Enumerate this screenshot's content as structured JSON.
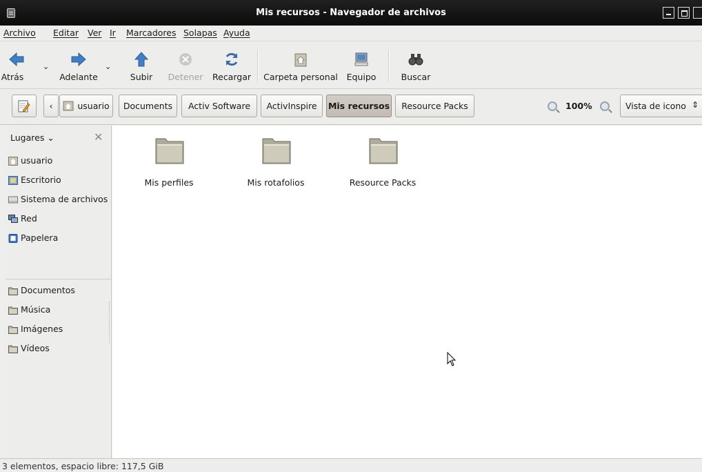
{
  "window": {
    "title": "Mis recursos - Navegador de archivos"
  },
  "menubar": {
    "items": [
      "Archivo",
      "Editar",
      "Ver",
      "Ir",
      "Marcadores",
      "Solapas",
      "Ayuda"
    ]
  },
  "toolbar": {
    "back": "Atrás",
    "forward": "Adelante",
    "up": "Subir",
    "stop": "Detener",
    "reload": "Recargar",
    "home": "Carpeta personal",
    "computer": "Equipo",
    "search": "Buscar"
  },
  "location": {
    "back_arrow": "‹",
    "path": [
      "usuario",
      "Documents",
      "Activ Software",
      "ActivInspire",
      "Mis recursos",
      "Resource Packs"
    ],
    "active": "Mis recursos",
    "zoom": "100%",
    "view": "Vista de icono",
    "view_arrow": "⇕"
  },
  "sidebar": {
    "header": "Lugares",
    "close": "✕",
    "places": [
      {
        "label": "usuario",
        "icon": "home-folder-icon"
      },
      {
        "label": "Escritorio",
        "icon": "desktop-icon"
      },
      {
        "label": "Sistema de archivos",
        "icon": "drive-icon"
      },
      {
        "label": "Red",
        "icon": "network-icon"
      },
      {
        "label": "Papelera",
        "icon": "trash-icon"
      }
    ],
    "bookmarks": [
      {
        "label": "Documentos",
        "icon": "folder-icon"
      },
      {
        "label": "Música",
        "icon": "folder-icon"
      },
      {
        "label": "Imágenes",
        "icon": "folder-icon"
      },
      {
        "label": "Vídeos",
        "icon": "folder-icon"
      }
    ]
  },
  "files": [
    {
      "name": "Mis perfiles"
    },
    {
      "name": "Mis rotafolios"
    },
    {
      "name": "Resource Packs"
    }
  ],
  "status": {
    "text": "3 elementos, espacio libre: 117,5 GiB"
  }
}
